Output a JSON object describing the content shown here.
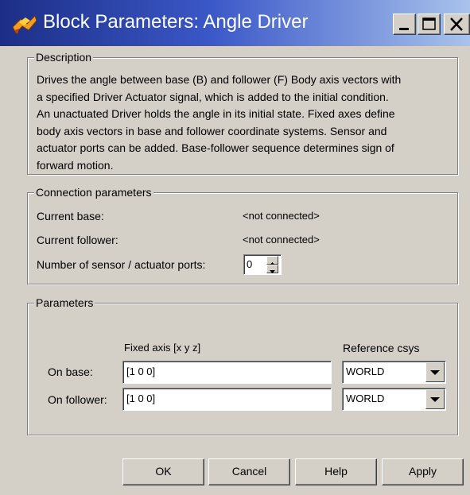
{
  "window": {
    "title": "Block Parameters: Angle Driver",
    "icon": "simulink-block-icon",
    "controls": [
      "minimize-icon",
      "maximize-icon",
      "close-icon"
    ]
  },
  "description": {
    "legend": "Description",
    "lines": [
      "Drives the angle between base (B) and follower (F) Body axis vectors with",
      "a specified Driver Actuator signal, which is added to the initial condition.",
      "An unactuated Driver holds the angle in its initial state. Fixed axes define",
      "body axis vectors in base and follower coordinate systems. Sensor and",
      "actuator ports can be added. Base-follower sequence determines sign of",
      "forward motion."
    ]
  },
  "connection": {
    "legend": "Connection parameters",
    "current_base_label": "Current base:",
    "current_base_value": "<not connected>",
    "current_follower_label": "Current follower:",
    "current_follower_value": "<not connected>",
    "ports_label": "Number of sensor / actuator ports:",
    "ports_value": "0"
  },
  "parameters": {
    "legend": "Parameters",
    "fixed_axis_header": "Fixed axis [x y z]",
    "reference_header": "Reference csys",
    "rows": [
      {
        "label": "On base:",
        "axis": "[1 0 0]",
        "csys": "WORLD"
      },
      {
        "label": "On follower:",
        "axis": "[1 0 0]",
        "csys": "WORLD"
      }
    ]
  },
  "buttons": {
    "ok": "OK",
    "cancel": "Cancel",
    "help": "Help",
    "apply": "Apply"
  }
}
